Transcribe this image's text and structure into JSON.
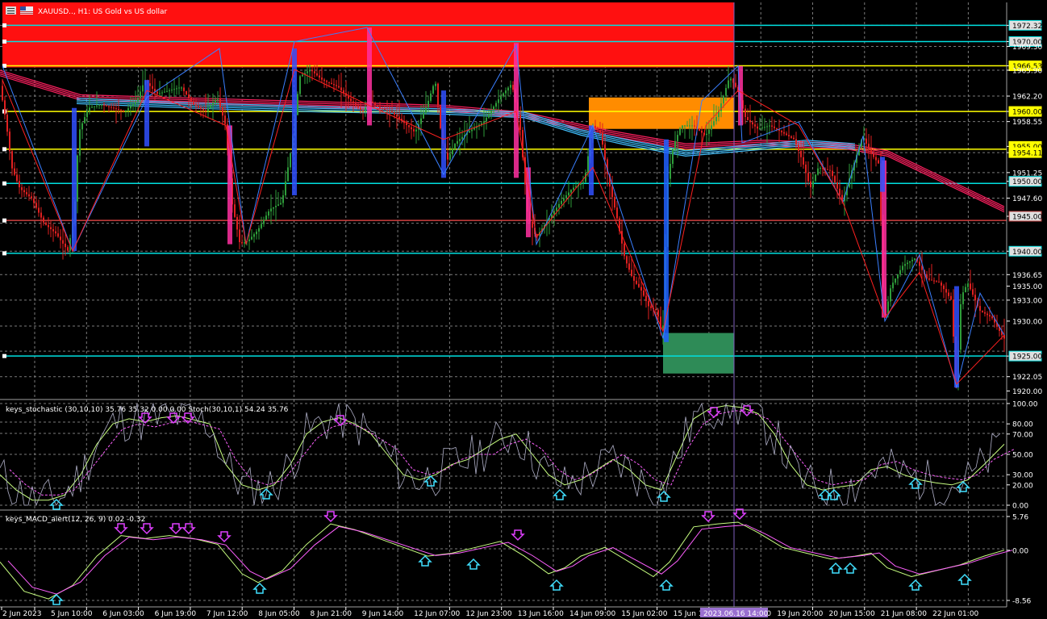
{
  "window": {
    "title": "XAUUSD.., H1:  US Gold vs US dollar",
    "stoch_title": "keys_stochastic (30,10,10) 35.76 35.32 0.00 0.00 Stoch(30,10,1) 54.24 35.76",
    "macd_title": "keys_MACD_alert(12, 26, 9) 0.02 -0.32",
    "crosshair_time": "2023.06.16 14:00"
  },
  "price_axis": {
    "labels": [
      "1972.32",
      "1970.00",
      "1969.30",
      "1966.53",
      "1965.90",
      "1962.20",
      "1960.00",
      "1958.55",
      "1955.00",
      "1954.11",
      "1951.25",
      "1950.00",
      "1947.60",
      "1945.00",
      "1940.00",
      "1936.65",
      "1935.00",
      "1933.00",
      "1930.00",
      "1925.00",
      "1922.05",
      "1920.00"
    ],
    "y": [
      1972.32,
      1970.0,
      1969.3,
      1966.53,
      1965.9,
      1962.2,
      1960.0,
      1958.55,
      1955.0,
      1954.11,
      1951.25,
      1950.0,
      1947.6,
      1945.0,
      1940.0,
      1936.65,
      1935.0,
      1933.0,
      1930.0,
      1925.0,
      1922.05,
      1920.0
    ],
    "range": [
      1918.9,
      1975.6
    ]
  },
  "stoch_axis": {
    "labels": [
      "100.00",
      "80.00",
      "70.00",
      "50.00",
      "30.00",
      "20.00",
      "0.00"
    ]
  },
  "macd_axis": {
    "labels": [
      "5.76",
      "0.00",
      "-8.56"
    ]
  },
  "time_axis": {
    "labels": [
      "2 Jun 2023",
      "5 Jun 10:00",
      "6 Jun 03:00",
      "6 Jun 19:00",
      "7 Jun 12:00",
      "8 Jun 05:00",
      "8 Jun 21:00",
      "9 Jun 14:00",
      "12 Jun 07:00",
      "12 Jun 23:00",
      "13 Jun 16:00",
      "14 Jun 09:00",
      "15 Jun 02:00",
      "15 Jun 18:00",
      "19 Jun 04:00",
      "19 Jun 20:00",
      "20 Jun 15:00",
      "21 Jun 08:00",
      "22 Jun 01:00"
    ]
  },
  "chart_data": {
    "type": "candlestick",
    "title": "XAUUSD.., H1:  US Gold vs US dollar",
    "horizontal_levels": [
      {
        "price": 1972.32,
        "color": "#00e0e0"
      },
      {
        "price": 1970.0,
        "color": "#00e0e0"
      },
      {
        "price": 1966.53,
        "color": "#ffff00"
      },
      {
        "price": 1960.0,
        "color": "#ffff00"
      },
      {
        "price": 1954.6,
        "color": "#ffff00"
      },
      {
        "price": 1949.7,
        "color": "#00e0e0"
      },
      {
        "price": 1944.4,
        "color": "#d04040"
      },
      {
        "price": 1939.7,
        "color": "#00e0e0"
      },
      {
        "price": 1925.0,
        "color": "#00e0e0"
      }
    ],
    "zones": [
      {
        "price_top": 1975.6,
        "price_bottom": 1966.3,
        "color": "#ff1010"
      },
      {
        "price_top": 1962.0,
        "price_bottom": 1957.5,
        "color": "#ff8c00"
      },
      {
        "price_top": 1928.3,
        "price_bottom": 1922.5,
        "color": "#2e8b57"
      }
    ],
    "price_path": [
      [
        0,
        1964.0
      ],
      [
        8,
        1958.5
      ],
      [
        15,
        1952.0
      ],
      [
        25,
        1949.0
      ],
      [
        40,
        1947.5
      ],
      [
        55,
        1944.0
      ],
      [
        70,
        1942.5
      ],
      [
        85,
        1940.0
      ],
      [
        93,
        1946.0
      ],
      [
        98,
        1957.0
      ],
      [
        110,
        1960.5
      ],
      [
        125,
        1961.0
      ],
      [
        140,
        1960.5
      ],
      [
        155,
        1960.0
      ],
      [
        170,
        1961.5
      ],
      [
        180,
        1964.5
      ],
      [
        195,
        1962.5
      ],
      [
        210,
        1963.0
      ],
      [
        225,
        1963.5
      ],
      [
        240,
        1961.0
      ],
      [
        255,
        1960.0
      ],
      [
        270,
        1962.0
      ],
      [
        280,
        1958.0
      ],
      [
        288,
        1947.0
      ],
      [
        298,
        1941.0
      ],
      [
        308,
        1941.5
      ],
      [
        320,
        1943.0
      ],
      [
        335,
        1946.0
      ],
      [
        350,
        1947.0
      ],
      [
        362,
        1955.0
      ],
      [
        372,
        1965.0
      ],
      [
        385,
        1966.0
      ],
      [
        400,
        1964.5
      ],
      [
        420,
        1963.5
      ],
      [
        435,
        1961.5
      ],
      [
        450,
        1960.0
      ],
      [
        460,
        1961.5
      ],
      [
        470,
        1960.5
      ],
      [
        485,
        1960.0
      ],
      [
        500,
        1958.5
      ],
      [
        515,
        1957.0
      ],
      [
        530,
        1961.0
      ],
      [
        540,
        1964.5
      ],
      [
        548,
        1956.0
      ],
      [
        555,
        1953.0
      ],
      [
        565,
        1955.5
      ],
      [
        580,
        1957.0
      ],
      [
        600,
        1958.5
      ],
      [
        620,
        1962.0
      ],
      [
        635,
        1964.0
      ],
      [
        645,
        1958.0
      ],
      [
        655,
        1945.0
      ],
      [
        665,
        1942.0
      ],
      [
        680,
        1944.5
      ],
      [
        695,
        1947.0
      ],
      [
        710,
        1949.0
      ],
      [
        725,
        1950.0
      ],
      [
        735,
        1958.0
      ],
      [
        745,
        1957.0
      ],
      [
        755,
        1950.0
      ],
      [
        765,
        1945.0
      ],
      [
        775,
        1939.0
      ],
      [
        785,
        1936.0
      ],
      [
        795,
        1934.5
      ],
      [
        805,
        1932.0
      ],
      [
        815,
        1931.5
      ],
      [
        822,
        1927.5
      ],
      [
        828,
        1950.0
      ],
      [
        835,
        1955.0
      ],
      [
        845,
        1958.0
      ],
      [
        860,
        1958.0
      ],
      [
        875,
        1956.5
      ],
      [
        890,
        1959.5
      ],
      [
        905,
        1965.0
      ],
      [
        915,
        1963.0
      ],
      [
        925,
        1959.0
      ],
      [
        940,
        1957.5
      ],
      [
        955,
        1958.0
      ],
      [
        970,
        1957.0
      ],
      [
        985,
        1956.0
      ],
      [
        995,
        1953.0
      ],
      [
        1005,
        1949.0
      ],
      [
        1015,
        1952.0
      ],
      [
        1030,
        1951.5
      ],
      [
        1045,
        1947.0
      ],
      [
        1055,
        1951.0
      ],
      [
        1070,
        1956.5
      ],
      [
        1080,
        1954.0
      ],
      [
        1090,
        1952.5
      ],
      [
        1097,
        1930.0
      ],
      [
        1105,
        1935.0
      ],
      [
        1120,
        1938.0
      ],
      [
        1135,
        1939.0
      ],
      [
        1150,
        1936.0
      ],
      [
        1165,
        1935.5
      ],
      [
        1180,
        1933.0
      ],
      [
        1186,
        1920.5
      ],
      [
        1192,
        1933.5
      ],
      [
        1200,
        1935.5
      ],
      [
        1215,
        1931.5
      ],
      [
        1230,
        1930.5
      ],
      [
        1245,
        1927.5
      ]
    ],
    "moving_averages": [
      {
        "color": "#ff2060",
        "points": [
          [
            0,
            1965.5
          ],
          [
            100,
            1962.0
          ],
          [
            250,
            1961.5
          ],
          [
            400,
            1961.0
          ],
          [
            550,
            1960.5
          ],
          [
            650,
            1959.5
          ],
          [
            750,
            1957.0
          ],
          [
            850,
            1955.0
          ],
          [
            950,
            1955.5
          ],
          [
            1050,
            1955.0
          ],
          [
            1100,
            1954.0
          ],
          [
            1200,
            1948.5
          ],
          [
            1245,
            1946.0
          ]
        ]
      },
      {
        "color": "#40c0ff",
        "points": [
          [
            95,
            1961.5
          ],
          [
            250,
            1960.8
          ],
          [
            400,
            1960.3
          ],
          [
            550,
            1960.0
          ],
          [
            650,
            1959.5
          ],
          [
            720,
            1957.0
          ],
          [
            780,
            1955.5
          ],
          [
            850,
            1954.0
          ],
          [
            950,
            1955.0
          ],
          [
            1000,
            1955.5
          ],
          [
            1060,
            1955.0
          ]
        ]
      }
    ],
    "indicators": {
      "stochastic": {
        "params": "(30,10,10) / Stoch(30,10,1)",
        "values": {
          "main": 35.76,
          "signal": 35.32,
          "stoch_main": 54.24,
          "stoch_signal": 35.76
        },
        "ylim": [
          0,
          100
        ],
        "main_line": [
          [
            0,
            30
          ],
          [
            20,
            15
          ],
          [
            40,
            5
          ],
          [
            60,
            5
          ],
          [
            80,
            10
          ],
          [
            100,
            30
          ],
          [
            120,
            60
          ],
          [
            140,
            80
          ],
          [
            160,
            85
          ],
          [
            180,
            82
          ],
          [
            200,
            86
          ],
          [
            220,
            88
          ],
          [
            240,
            84
          ],
          [
            260,
            80
          ],
          [
            280,
            40
          ],
          [
            300,
            20
          ],
          [
            320,
            15
          ],
          [
            340,
            20
          ],
          [
            360,
            40
          ],
          [
            380,
            70
          ],
          [
            400,
            82
          ],
          [
            420,
            86
          ],
          [
            440,
            80
          ],
          [
            460,
            70
          ],
          [
            480,
            50
          ],
          [
            500,
            30
          ],
          [
            520,
            25
          ],
          [
            540,
            30
          ],
          [
            560,
            40
          ],
          [
            580,
            45
          ],
          [
            600,
            55
          ],
          [
            620,
            65
          ],
          [
            640,
            70
          ],
          [
            660,
            50
          ],
          [
            680,
            30
          ],
          [
            700,
            20
          ],
          [
            720,
            25
          ],
          [
            740,
            35
          ],
          [
            760,
            45
          ],
          [
            780,
            35
          ],
          [
            800,
            20
          ],
          [
            820,
            15
          ],
          [
            840,
            50
          ],
          [
            860,
            85
          ],
          [
            880,
            95
          ],
          [
            900,
            98
          ],
          [
            920,
            96
          ],
          [
            940,
            90
          ],
          [
            960,
            70
          ],
          [
            980,
            40
          ],
          [
            1000,
            20
          ],
          [
            1020,
            15
          ],
          [
            1040,
            18
          ],
          [
            1060,
            20
          ],
          [
            1080,
            35
          ],
          [
            1100,
            38
          ],
          [
            1120,
            30
          ],
          [
            1140,
            25
          ],
          [
            1160,
            22
          ],
          [
            1180,
            20
          ],
          [
            1200,
            25
          ],
          [
            1220,
            40
          ],
          [
            1245,
            60
          ]
        ]
      },
      "macd": {
        "params": "(12, 26, 9)",
        "values": {
          "macd": 0.02,
          "signal": -0.32
        },
        "ylim": [
          -8.56,
          5.76
        ],
        "main_line": [
          [
            0,
            -2
          ],
          [
            30,
            -7
          ],
          [
            60,
            -8.3
          ],
          [
            90,
            -6
          ],
          [
            120,
            -1
          ],
          [
            150,
            2.5
          ],
          [
            180,
            2.0
          ],
          [
            210,
            2.5
          ],
          [
            240,
            2.0
          ],
          [
            270,
            1.0
          ],
          [
            300,
            -4
          ],
          [
            320,
            -5.5
          ],
          [
            350,
            -3.5
          ],
          [
            380,
            1
          ],
          [
            410,
            4.5
          ],
          [
            440,
            3.5
          ],
          [
            470,
            2
          ],
          [
            500,
            0.5
          ],
          [
            530,
            -1
          ],
          [
            560,
            -0.5
          ],
          [
            590,
            0.5
          ],
          [
            620,
            1.5
          ],
          [
            650,
            -1
          ],
          [
            680,
            -4
          ],
          [
            700,
            -3
          ],
          [
            720,
            -1
          ],
          [
            750,
            0.5
          ],
          [
            780,
            -2
          ],
          [
            810,
            -4.5
          ],
          [
            830,
            -2
          ],
          [
            860,
            4
          ],
          [
            890,
            4.5
          ],
          [
            915,
            4.8
          ],
          [
            940,
            3
          ],
          [
            970,
            0.5
          ],
          [
            1000,
            -0.5
          ],
          [
            1030,
            -1.5
          ],
          [
            1060,
            -1
          ],
          [
            1080,
            -0.5
          ],
          [
            1100,
            -3
          ],
          [
            1130,
            -4.5
          ],
          [
            1160,
            -3.5
          ],
          [
            1190,
            -2.5
          ],
          [
            1220,
            -1
          ],
          [
            1245,
            0.02
          ]
        ]
      }
    },
    "marker_price": 1966.53,
    "ylim": [
      1918.9,
      1975.6
    ]
  }
}
